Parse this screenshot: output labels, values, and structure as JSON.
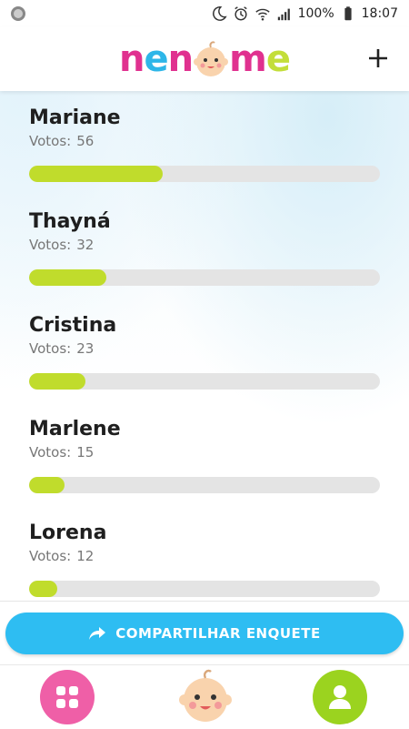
{
  "statusbar": {
    "battery": "100%",
    "time": "18:07"
  },
  "header": {
    "logo_letters": [
      {
        "char": "n",
        "color": "#e0318f"
      },
      {
        "char": "e",
        "color": "#2eb6e8"
      },
      {
        "char": "n",
        "color": "#e0318f"
      },
      {
        "char": "",
        "color": "#f5c9a0"
      },
      {
        "char": "m",
        "color": "#e0318f"
      },
      {
        "char": "e",
        "color": "#c3de3a"
      }
    ],
    "add_icon": "plus-icon"
  },
  "poll": {
    "votes_label": "Votos:",
    "max_votes": 100,
    "items": [
      {
        "name": "Mariane",
        "votes": "56",
        "fraction": 0.38
      },
      {
        "name": "Thayná",
        "votes": "32",
        "fraction": 0.22
      },
      {
        "name": "Cristina",
        "votes": "23",
        "fraction": 0.16
      },
      {
        "name": "Marlene",
        "votes": "15",
        "fraction": 0.1
      },
      {
        "name": "Lorena",
        "votes": "12",
        "fraction": 0.08
      }
    ]
  },
  "share_button": {
    "label": "COMPARTILHAR ENQUETE",
    "icon": "share-arrow-icon"
  },
  "bottom_nav": {
    "grid_icon": "grid-icon",
    "baby_icon": "baby-face-icon",
    "profile_icon": "user-icon"
  },
  "colors": {
    "accent_blue": "#2ebdf2",
    "bar_fill": "#c0dc2c",
    "bar_track": "#e4e4e4",
    "pink": "#ef5fa7",
    "green": "#9bd31f"
  }
}
